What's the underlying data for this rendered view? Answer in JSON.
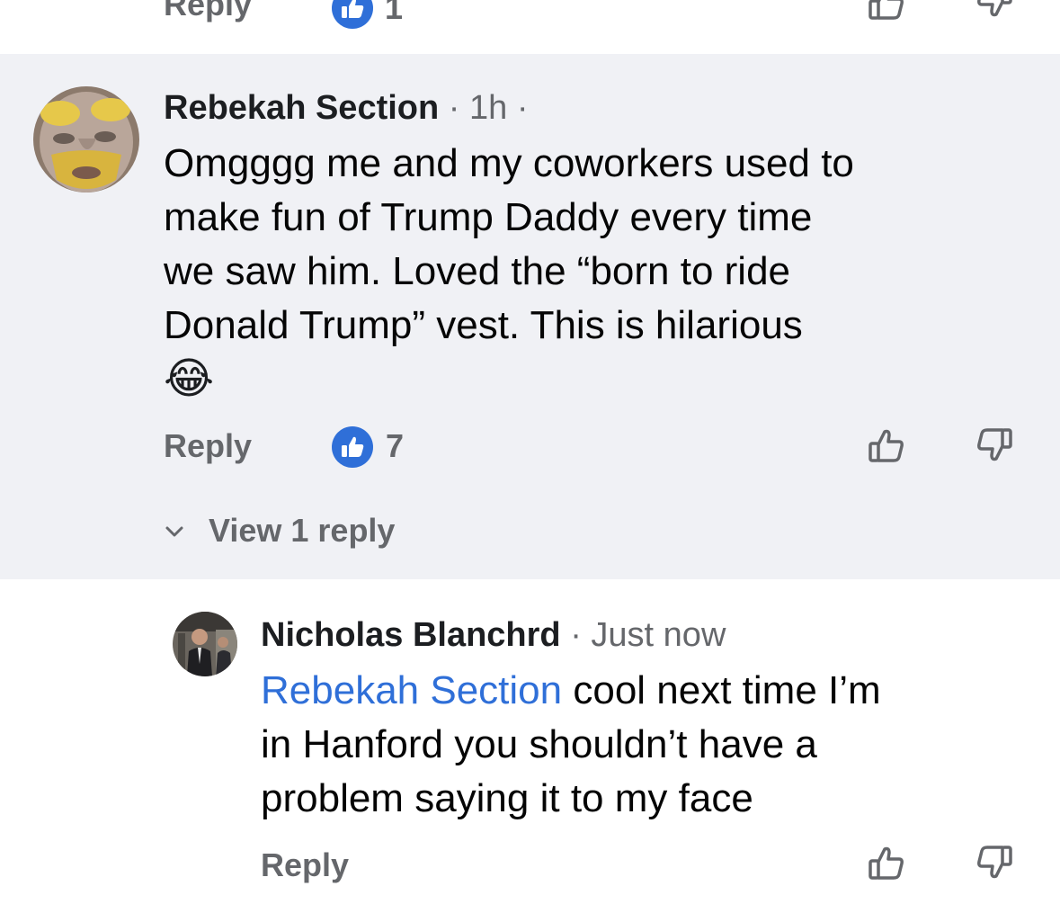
{
  "previous_comment": {
    "reply_label": "Reply",
    "like_count": "1"
  },
  "comment": {
    "author": "Rebekah Section",
    "separator": "·",
    "time": "1h",
    "trailing_dot": "·",
    "lines": [
      "Omgggg me and my coworkers used to",
      "make fun of Trump Daddy every time",
      "we saw him. Loved the “born to ride",
      "Donald Trump” vest. This is hilarious"
    ],
    "emoji": "😂",
    "reply_label": "Reply",
    "like_count": "7",
    "view_replies_label": "View 1 reply"
  },
  "reply": {
    "author": "Nicholas Blanchrd",
    "separator": "·",
    "time": "Just now",
    "mention": "Rebekah Section",
    "first_line_rest": " cool next time I’m",
    "lines": [
      "in Hanford you shouldn’t have a",
      "problem saying it to my face"
    ],
    "reply_label": "Reply"
  },
  "icons": {
    "like_badge": "thumbs-up-badge-icon",
    "like_button": "thumbs-up-outline-icon",
    "dislike_button": "thumbs-down-outline-icon",
    "expand": "chevron-down-icon"
  },
  "colors": {
    "highlight_background": "#f0f1f5",
    "like_blue": "#2f6fd8",
    "mention_blue": "#2f6fd8",
    "secondary_text": "#65676b"
  }
}
